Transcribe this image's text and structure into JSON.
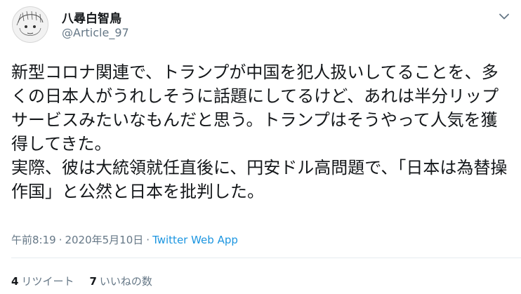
{
  "user": {
    "display_name": "八尋白智鳥",
    "handle": "@Article_97"
  },
  "tweet": {
    "text": "新型コロナ関連で、トランプが中国を犯人扱いしてることを、多くの日本人がうれしそうに話題にしてるけど、あれは半分リップサービスみたいなもんだと思う。トランプはそうやって人気を獲得してきた。\n実際、彼は大統領就任直後に、円安ドル高問題で、「日本は為替操作国」と公然と日本を批判した。",
    "time": "午前8:19",
    "separator": "·",
    "date": "2020年5月10日",
    "source": "Twitter Web App"
  },
  "stats": {
    "retweets_count": "4",
    "retweets_label": "リツイート",
    "likes_count": "7",
    "likes_label": "いいねの数"
  },
  "icons": {
    "avatar": "sketch-face-avatar",
    "menu": "chevron-down-icon"
  },
  "colors": {
    "text": "#14171a",
    "secondary": "#657786",
    "link": "#1b95e0"
  }
}
